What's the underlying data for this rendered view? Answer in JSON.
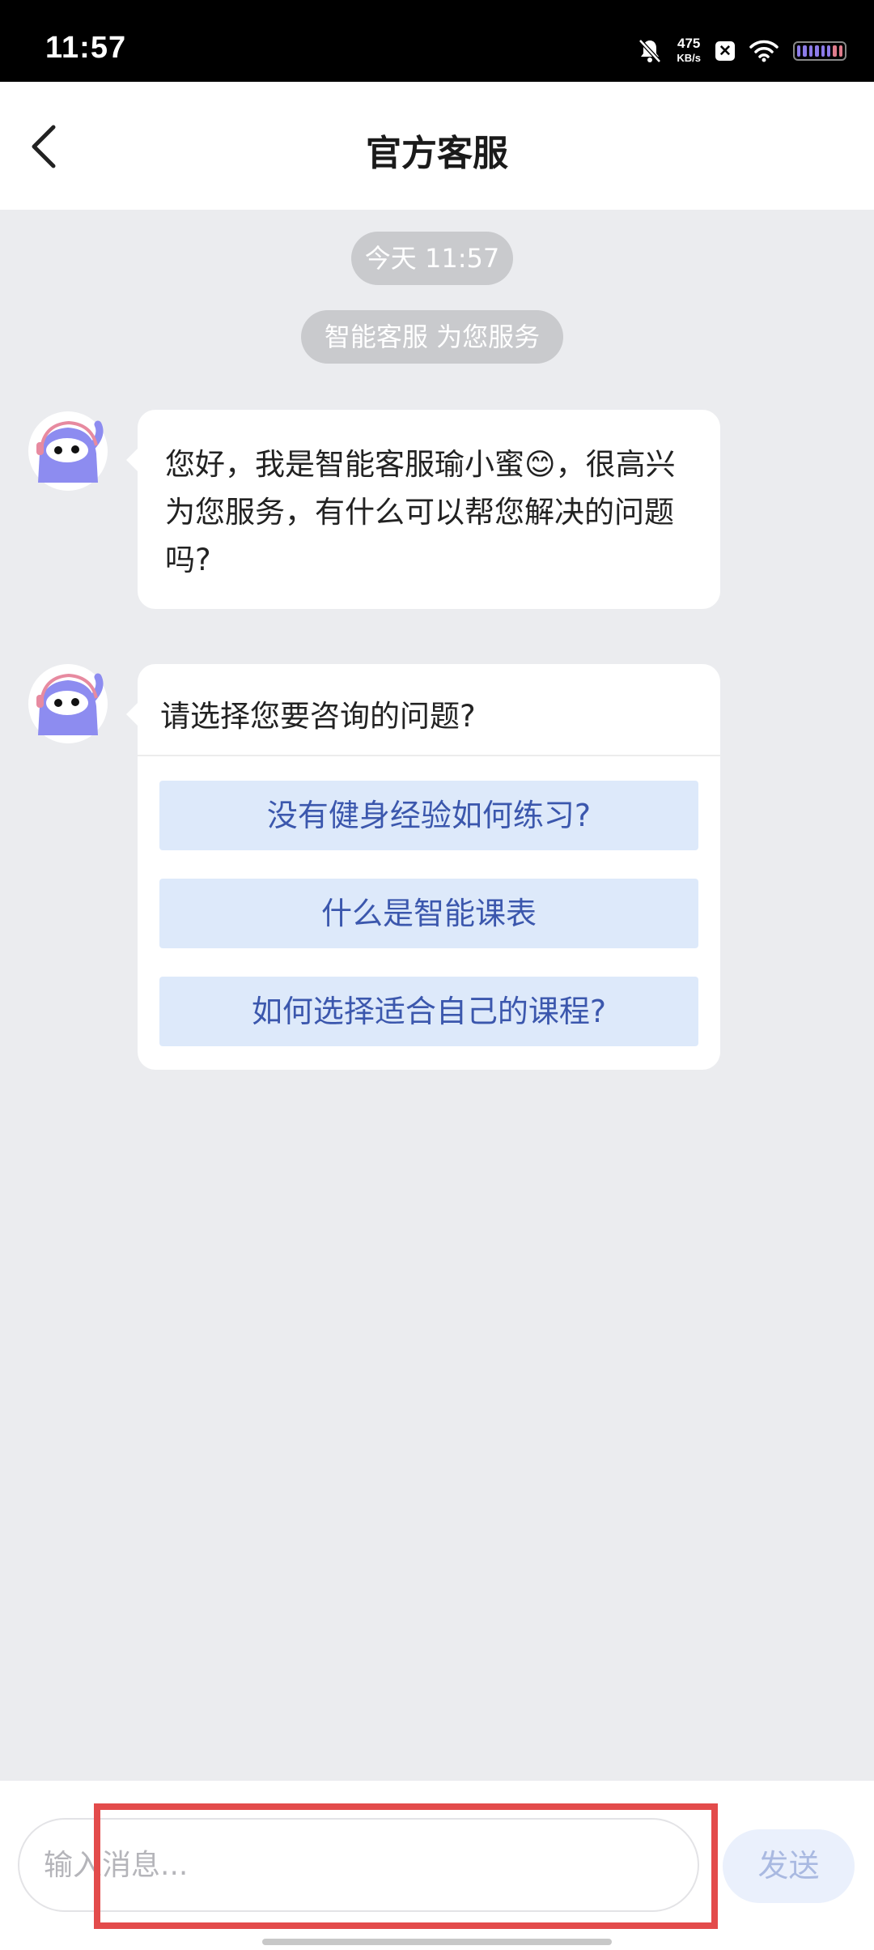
{
  "status_bar": {
    "time": "11:57",
    "net_speed_value": "475",
    "net_speed_unit": "KB/s",
    "icons": [
      "bell-muted-icon",
      "x-app-icon",
      "wifi-icon",
      "battery-icon"
    ]
  },
  "header": {
    "title": "官方客服",
    "back_icon": "chevron-left-icon"
  },
  "chat": {
    "timestamp": "今天 11:57",
    "service_notice": "智能客服 为您服务",
    "welcome_message": "您好，我是智能客服瑜小蜜😊，很高兴为您服务，有什么可以帮您解决的问题吗?",
    "question_card": {
      "title": "请选择您要咨询的问题?",
      "options": [
        "没有健身经验如何练习?",
        "什么是智能课表",
        "如何选择适合自己的课程?"
      ]
    }
  },
  "composer": {
    "placeholder": "输入消息...",
    "value": "",
    "send_label": "发送"
  },
  "colors": {
    "chat_background": "#ebecef",
    "option_background": "#dde9fa",
    "option_text": "#3b57ad",
    "send_button_bg": "#eaf0fc",
    "highlight": "#e34b4b"
  }
}
